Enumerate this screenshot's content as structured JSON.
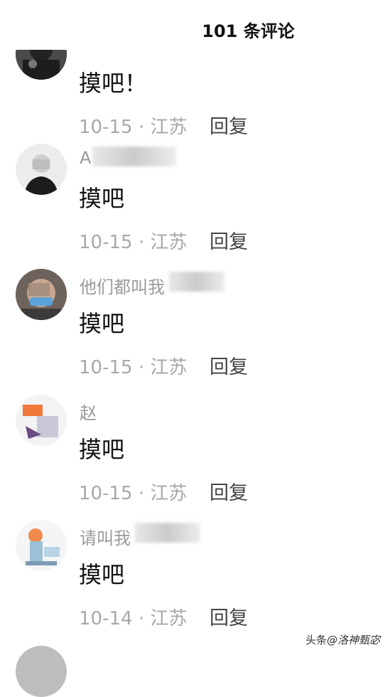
{
  "header": {
    "title": "101 条评论"
  },
  "comments": [
    {
      "username": "",
      "content": "摸吧！",
      "meta": "10-15 · 江苏",
      "reply_label": "回复"
    },
    {
      "username": "A",
      "content": "摸吧",
      "meta": "10-15 · 江苏",
      "reply_label": "回复"
    },
    {
      "username": "他们都叫我",
      "content": "摸吧",
      "meta": "10-15 · 江苏",
      "reply_label": "回复"
    },
    {
      "username": "赵",
      "content": "摸吧",
      "meta": "10-15 · 江苏",
      "reply_label": "回复"
    },
    {
      "username": "请叫我",
      "content": "摸吧",
      "meta": "10-14 · 江苏",
      "reply_label": "回复"
    }
  ],
  "watermark": {
    "source": "头条",
    "handle": "@洛神甄宓"
  }
}
